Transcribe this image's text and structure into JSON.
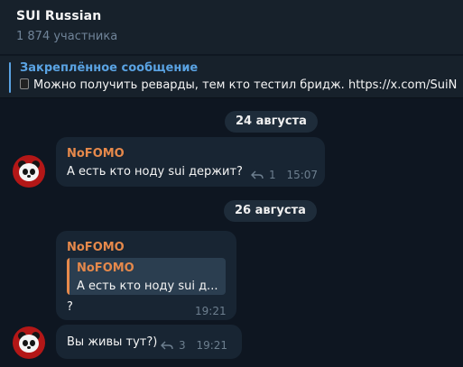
{
  "header": {
    "title": "SUI Russian",
    "members": "1 874 участника"
  },
  "pinned": {
    "label": "Закреплённое сообщение",
    "text": "Можно получить реварды, тем кто тестил бридж. https://x.com/SuiN"
  },
  "dates": [
    "24 августа",
    "26 августа"
  ],
  "messages": [
    {
      "sender": "NoFOMO",
      "text": "А есть кто ноду sui держит?",
      "replies": "1",
      "time": "15:07"
    },
    {
      "sender": "NoFOMO",
      "quote_sender": "NoFOMO",
      "quote_text": "А есть кто ноду sui д...",
      "text": "?",
      "time": "19:21"
    },
    {
      "text": "Вы живы тут?)",
      "replies": "3",
      "time": "19:21"
    }
  ],
  "colors": {
    "background": "#0e1621",
    "panel": "#17212b",
    "bubble": "#182533",
    "accent_link": "#5aa3e3",
    "sender_name": "#e6894b",
    "meta": "#6d7f8f"
  },
  "icons": {
    "reply": "reply-arrow-icon",
    "avatar": "panda-avatar",
    "pinned_prefix": "mobile-phone-icon"
  }
}
